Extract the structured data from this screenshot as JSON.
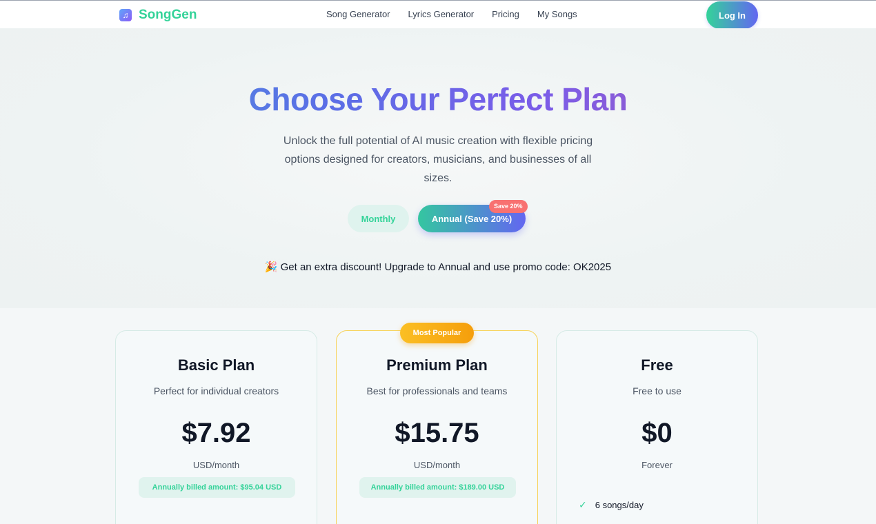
{
  "nav": {
    "brand": "SongGen",
    "brand_icon": "music-note-icon",
    "links": [
      "Song Generator",
      "Lyrics Generator",
      "Pricing",
      "My Songs"
    ],
    "login_label": "Log In"
  },
  "hero": {
    "title": "Choose Your Perfect Plan",
    "subtitle": "Unlock the full potential of AI music creation with flexible pricing options designed for creators, musicians, and businesses of all sizes.",
    "toggle": {
      "monthly_label": "Monthly",
      "annual_label": "Annual (Save 20%)",
      "selected": "annual",
      "save_badge": "Save 20%"
    },
    "promo_icon": "party-popper-icon",
    "promo_text": "Get an extra discount! Upgrade to Annual and use promo code: OK2025"
  },
  "plans": [
    {
      "name": "Basic Plan",
      "description": "Perfect for individual creators",
      "price": "$7.92",
      "unit": "USD/month",
      "billed": "Annually billed amount: $95.04 USD"
    },
    {
      "name": "Premium Plan",
      "badge": "Most Popular",
      "description": "Best for professionals and teams",
      "price": "$15.75",
      "unit": "USD/month",
      "billed": "Annually billed amount: $189.00 USD"
    },
    {
      "name": "Free",
      "description": "Free to use",
      "price": "$0",
      "unit": "Forever",
      "features": [
        "6 songs/day"
      ]
    }
  ],
  "colors": {
    "brand_green": "#34d399",
    "accent_indigo": "#6366f1",
    "badge_red": "#f87171",
    "popular_amber": "#fbbf24"
  }
}
